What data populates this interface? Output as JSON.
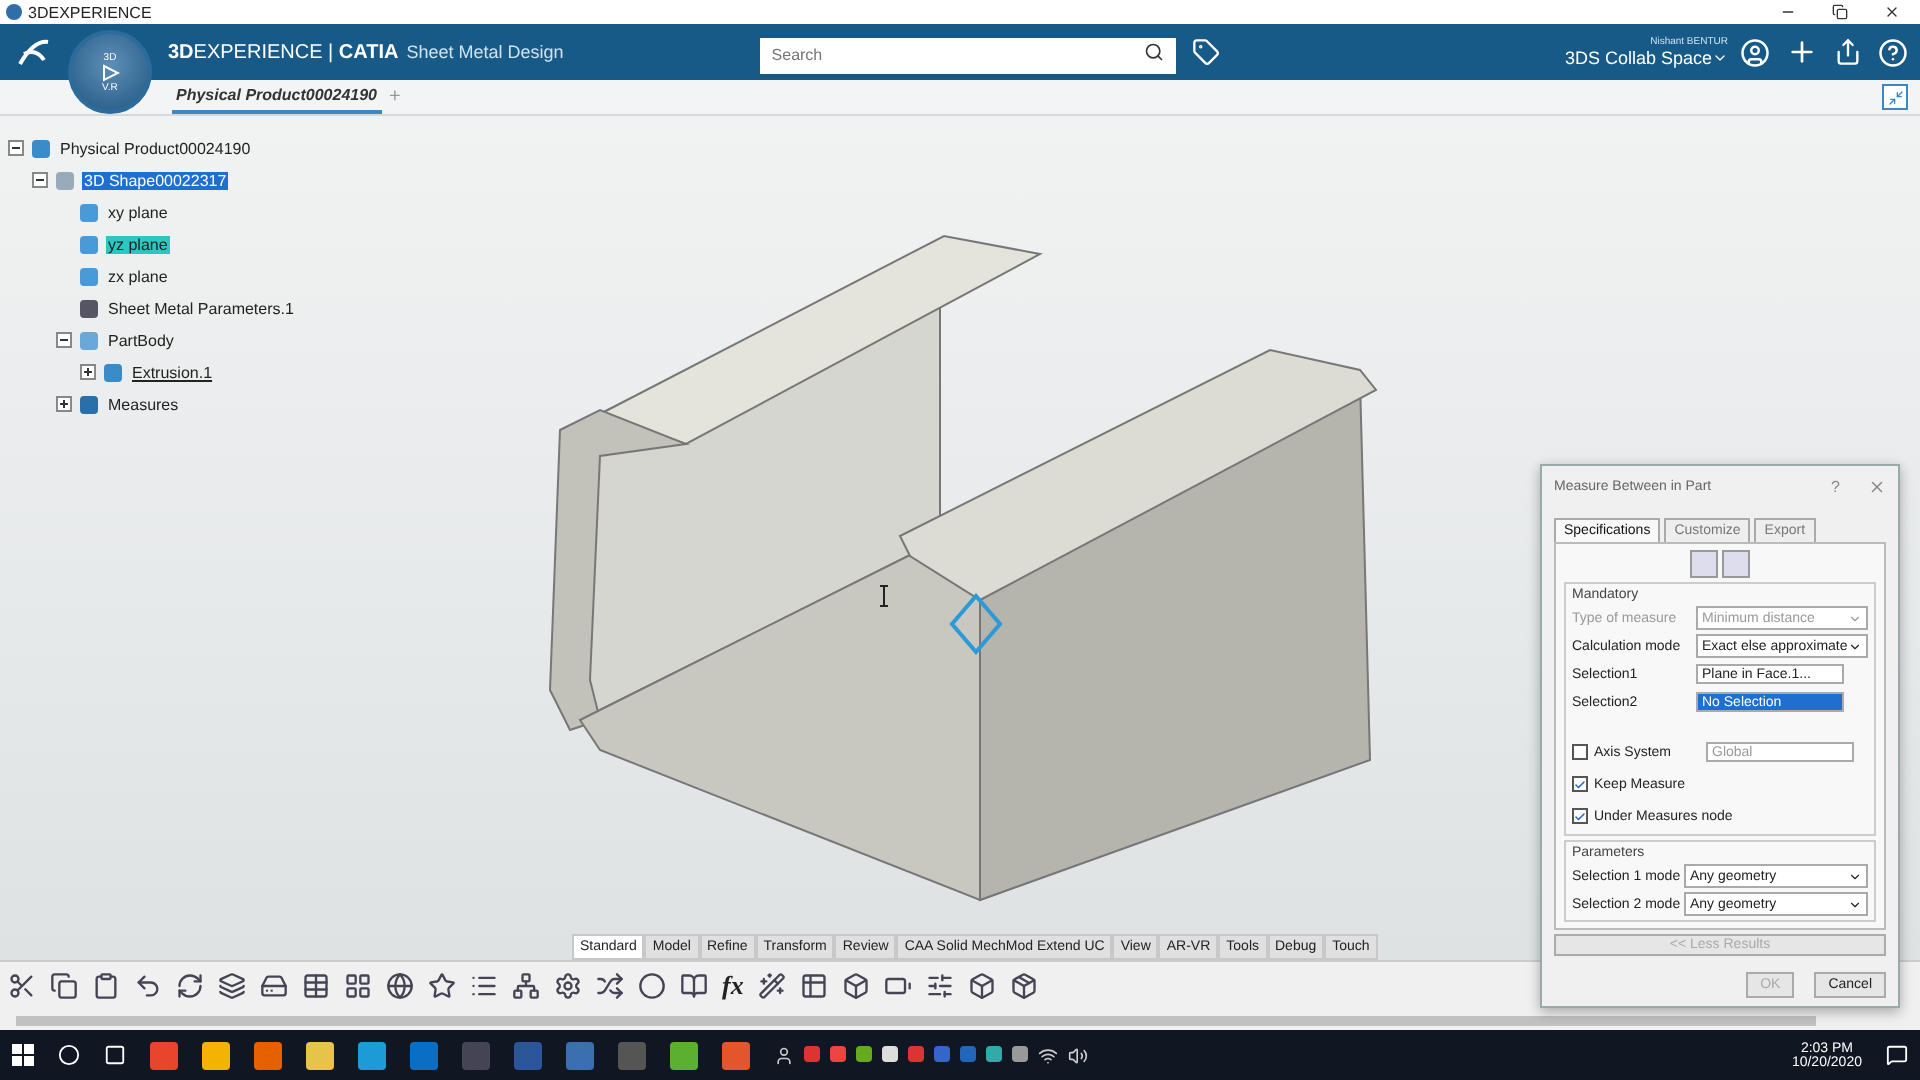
{
  "window": {
    "title": "3DEXPERIENCE"
  },
  "header": {
    "brand": "**3D**EXPERIENCE | **CATIA**",
    "app": "Sheet Metal Design",
    "compass_labels": [
      "3D",
      "V.R"
    ],
    "search": {
      "placeholder": "Search"
    },
    "user": "Nishant BENTUR",
    "space": "3DS Collab Space"
  },
  "tabs": [
    {
      "label": "Physical Product00024190",
      "selected": true
    }
  ],
  "new_tab": "+",
  "tree": {
    "label": "Physical Product00024190",
    "selected": false,
    "preselected": false,
    "expanded": true,
    "kind": "product",
    "children": [
      {
        "label": "3D Shape00022317",
        "selected": true,
        "preselected": false,
        "expanded": true,
        "kind": "shape",
        "children": [
          {
            "label": "xy plane",
            "selected": false,
            "preselected": false,
            "kind": "plane"
          },
          {
            "label": "yz plane",
            "selected": false,
            "preselected": true,
            "kind": "plane"
          },
          {
            "label": "zx plane",
            "selected": false,
            "preselected": false,
            "kind": "plane"
          },
          {
            "label": "Sheet Metal Parameters.1",
            "selected": false,
            "preselected": false,
            "kind": "params"
          },
          {
            "label": "PartBody",
            "selected": false,
            "preselected": false,
            "expanded": true,
            "kind": "body",
            "children": [
              {
                "label": "Extrusion.1",
                "selected": false,
                "preselected": false,
                "expanded": false,
                "kind": "feature"
              }
            ]
          },
          {
            "label": "Measures",
            "selected": false,
            "preselected": false,
            "expanded": false,
            "kind": "measures"
          }
        ]
      }
    ]
  },
  "toolbar_tabs": [
    {
      "label": "Standard",
      "selected": true
    },
    {
      "label": "Model",
      "selected": false
    },
    {
      "label": "Refine",
      "selected": false
    },
    {
      "label": "Transform",
      "selected": false
    },
    {
      "label": "Review",
      "selected": false
    },
    {
      "label": "CAA Solid MechMod Extend UC",
      "selected": false
    },
    {
      "label": "View",
      "selected": false
    },
    {
      "label": "AR-VR",
      "selected": false
    },
    {
      "label": "Tools",
      "selected": false
    },
    {
      "label": "Debug",
      "selected": false
    },
    {
      "label": "Touch",
      "selected": false
    }
  ],
  "toolbar": {
    "formula_label": "fx"
  },
  "dialog": {
    "title": "Measure Between in Part",
    "help": "?",
    "tabs": [
      {
        "label": "Specifications",
        "selected": true
      },
      {
        "label": "Customize",
        "selected": false
      },
      {
        "label": "Export",
        "selected": false
      }
    ],
    "mandatory": {
      "title": "Mandatory",
      "rows": [
        {
          "kind": "select",
          "label": "Type of measure",
          "value": "Minimum distance",
          "disabled": true
        },
        {
          "kind": "select",
          "label": "Calculation mode",
          "value": "Exact else approximate",
          "disabled": false
        },
        {
          "kind": "field",
          "label": "Selection1",
          "value": "Plane in Face.1...",
          "selected": false
        },
        {
          "kind": "field",
          "label": "Selection2",
          "value": "No Selection",
          "selected": true
        }
      ],
      "checks": [
        {
          "label": "Axis System",
          "checked": false,
          "field": "Global"
        },
        {
          "label": "Keep Measure",
          "checked": true
        },
        {
          "label": "Under Measures node",
          "checked": true
        }
      ]
    },
    "parameters": {
      "title": "Parameters",
      "rows": [
        {
          "label": "Selection 1 mode",
          "value": "Any geometry"
        },
        {
          "label": "Selection 2 mode",
          "value": "Any geometry"
        }
      ]
    },
    "less_button": {
      "label": "<< Less Results",
      "disabled": true
    },
    "buttons": [
      {
        "label": "OK",
        "disabled": true
      },
      {
        "label": "Cancel",
        "disabled": false
      }
    ]
  },
  "taskbar": {
    "time": "2:03 PM",
    "date": "10/20/2020"
  }
}
